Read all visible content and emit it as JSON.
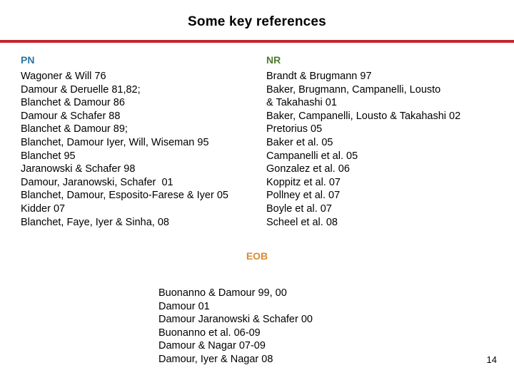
{
  "slide": {
    "title": "Some key references",
    "page_number": "14",
    "rule_color": "#C1272D",
    "background_color": "#ffffff"
  },
  "columns": {
    "left": {
      "heading": "PN",
      "heading_color": "#2E75A3",
      "items": [
        "Wagoner & Will 76",
        "Damour & Deruelle 81,82;",
        "Blanchet & Damour 86",
        "Damour & Schafer 88",
        "Blanchet & Damour 89;",
        "Blanchet, Damour Iyer, Will, Wiseman 95",
        "Blanchet 95",
        "Jaranowski & Schafer 98",
        "Damour, Jaranowski, Schafer  01",
        "Blanchet, Damour, Esposito-Farese & Iyer 05",
        "Kidder 07",
        "Blanchet, Faye, Iyer & Sinha, 08"
      ]
    },
    "right": {
      "heading": "NR",
      "heading_color": "#4F7A2E",
      "items": [
        "Brandt & Brugmann 97",
        "Baker, Brugmann, Campanelli, Lousto",
        "& Takahashi 01",
        "Baker, Campanelli, Lousto & Takahashi 02",
        "Pretorius 05",
        "Baker et al. 05",
        "Campanelli et al. 05",
        "Gonzalez et al. 06",
        "Koppitz et al. 07",
        "Pollney et al. 07",
        "Boyle et al. 07",
        "Scheel et al. 08"
      ]
    }
  },
  "eob": {
    "heading": "EOB",
    "heading_color": "#D98B33",
    "items": [
      "Buonanno & Damour 99, 00",
      "Damour 01",
      "Damour Jaranowski & Schafer 00",
      "Buonanno et al. 06-09",
      "Damour & Nagar 07-09",
      "Damour, Iyer & Nagar 08"
    ]
  }
}
